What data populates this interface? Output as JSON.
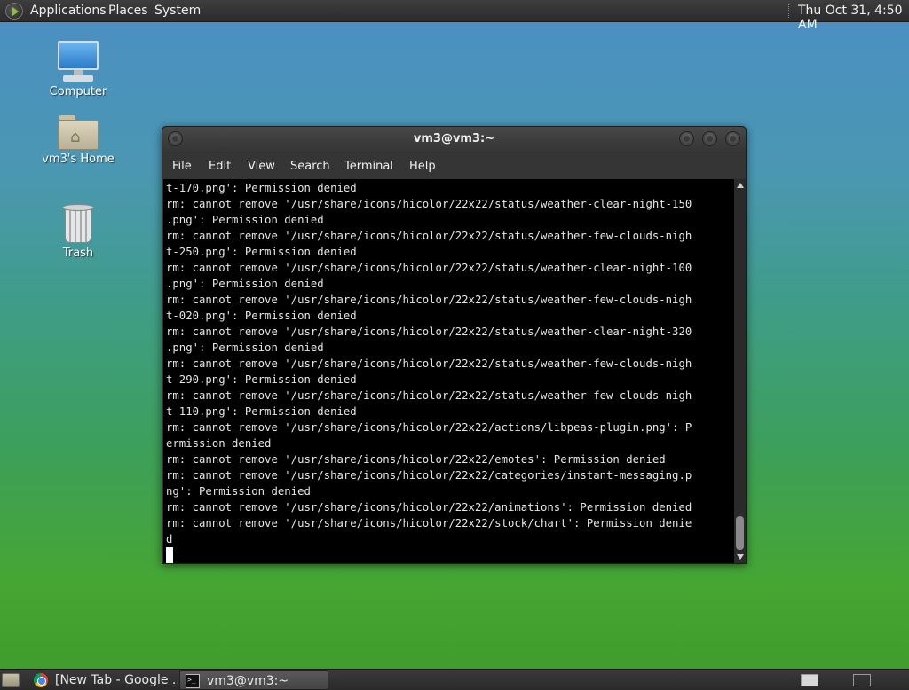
{
  "top_panel": {
    "menus": [
      "Applications",
      "Places",
      "System"
    ],
    "clock": "Thu Oct 31,  4:50 AM"
  },
  "desktop_icons": {
    "computer": "Computer",
    "home": "vm3's Home",
    "trash": "Trash"
  },
  "terminal": {
    "title": "vm3@vm3:~",
    "menu": [
      "File",
      "Edit",
      "View",
      "Search",
      "Terminal",
      "Help"
    ],
    "lines": [
      "t-170.png': Permission denied",
      "rm: cannot remove '/usr/share/icons/hicolor/22x22/status/weather-clear-night-150",
      ".png': Permission denied",
      "rm: cannot remove '/usr/share/icons/hicolor/22x22/status/weather-few-clouds-nigh",
      "t-250.png': Permission denied",
      "rm: cannot remove '/usr/share/icons/hicolor/22x22/status/weather-clear-night-100",
      ".png': Permission denied",
      "rm: cannot remove '/usr/share/icons/hicolor/22x22/status/weather-few-clouds-nigh",
      "t-020.png': Permission denied",
      "rm: cannot remove '/usr/share/icons/hicolor/22x22/status/weather-clear-night-320",
      ".png': Permission denied",
      "rm: cannot remove '/usr/share/icons/hicolor/22x22/status/weather-few-clouds-nigh",
      "t-290.png': Permission denied",
      "rm: cannot remove '/usr/share/icons/hicolor/22x22/status/weather-few-clouds-nigh",
      "t-110.png': Permission denied",
      "rm: cannot remove '/usr/share/icons/hicolor/22x22/actions/libpeas-plugin.png': P",
      "ermission denied",
      "rm: cannot remove '/usr/share/icons/hicolor/22x22/emotes': Permission denied",
      "rm: cannot remove '/usr/share/icons/hicolor/22x22/categories/instant-messaging.p",
      "ng': Permission denied",
      "rm: cannot remove '/usr/share/icons/hicolor/22x22/animations': Permission denied",
      "rm: cannot remove '/usr/share/icons/hicolor/22x22/stock/chart': Permission denie",
      "d"
    ]
  },
  "taskbar": {
    "items": [
      {
        "label": "[New Tab - Google ...",
        "icon": "chrome-icon",
        "active": false
      },
      {
        "label": "vm3@vm3:~",
        "icon": "terminal-icon",
        "active": true
      }
    ]
  },
  "colors": {
    "panel": "#2e2e2e",
    "terminal_bg": "#000000",
    "terminal_fg": "#e6e6e6",
    "desktop_top": "#4b8fc4",
    "desktop_bottom": "#3f9a2c"
  }
}
